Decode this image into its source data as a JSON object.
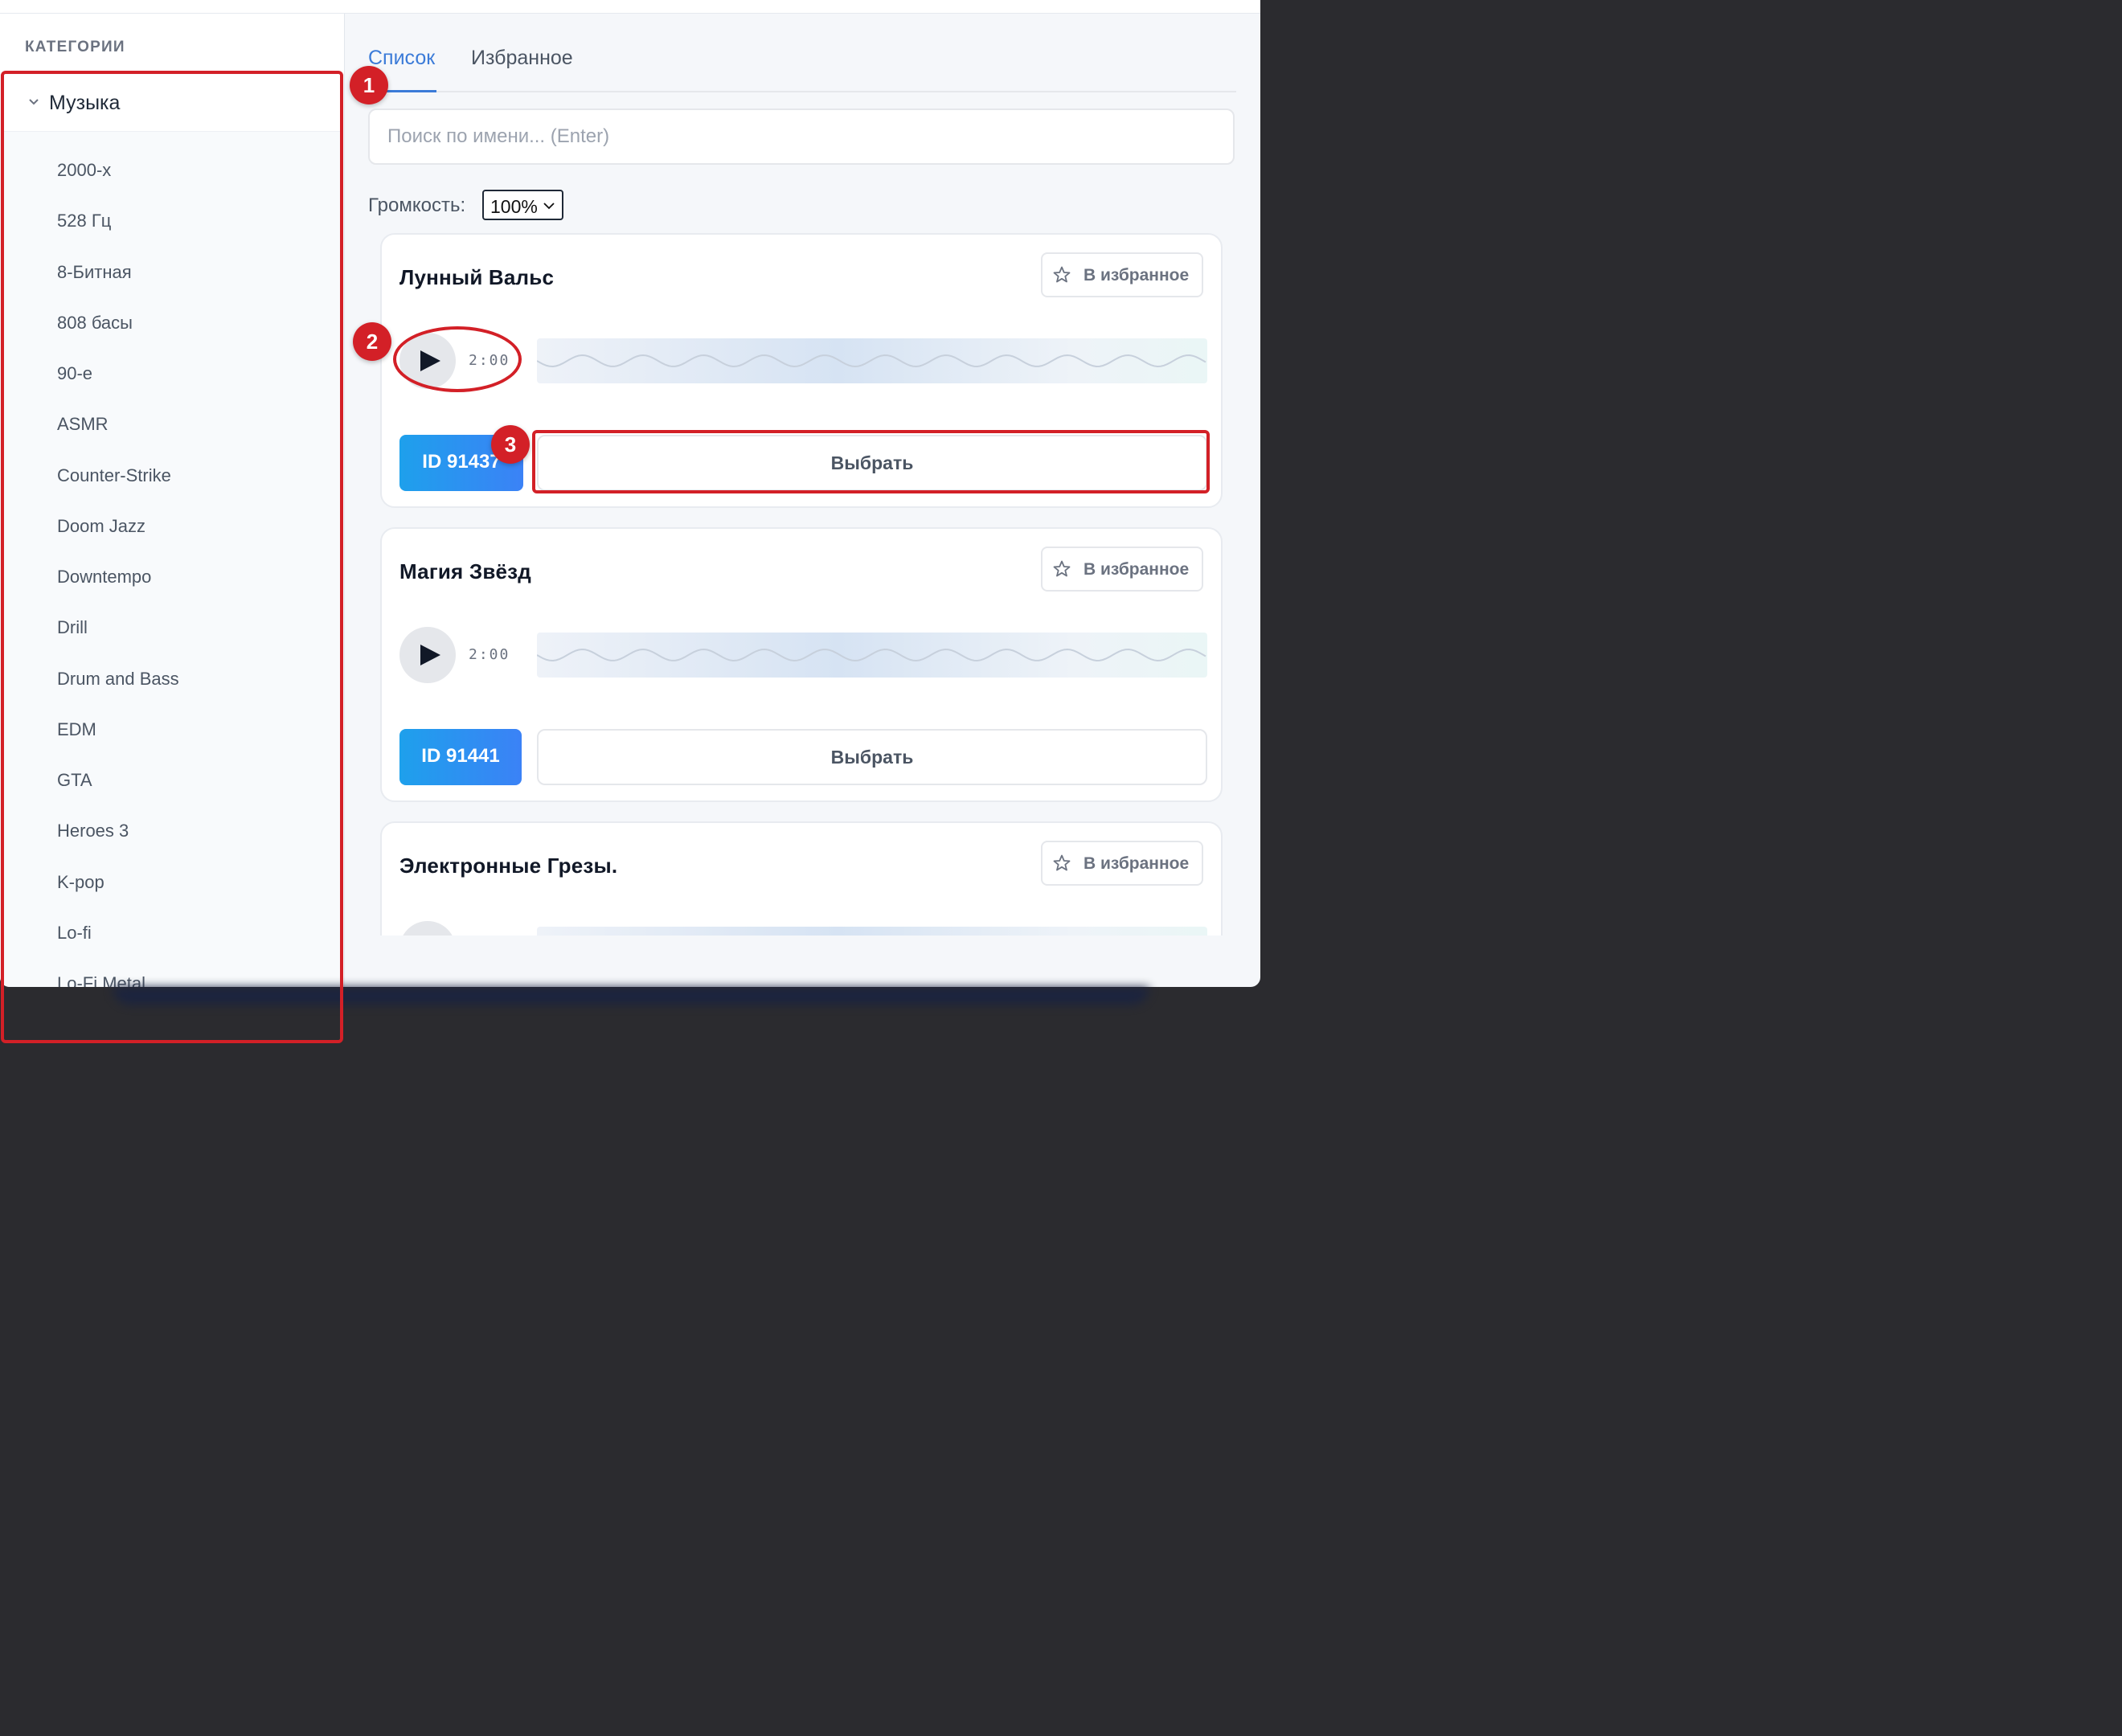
{
  "sidebar": {
    "title": "КАТЕГОРИИ",
    "group": {
      "label": "Музыка",
      "expanded": true
    },
    "items": [
      "2000-х",
      "528 Гц",
      "8-Битная",
      "808 басы",
      "90-е",
      "ASMR",
      "Counter-Strike",
      "Doom Jazz",
      "Downtempo",
      "Drill",
      "Drum and Bass",
      "EDM",
      "GTA",
      "Heroes 3",
      "K-pop",
      "Lo-fi",
      "Lo-Fi Metal"
    ]
  },
  "tabs": [
    {
      "label": "Список",
      "active": true
    },
    {
      "label": "Избранное",
      "active": false
    }
  ],
  "search": {
    "placeholder": "Поиск по имени... (Enter)",
    "value": ""
  },
  "volume": {
    "label": "Громкость:",
    "selected": "100%"
  },
  "tracks": [
    {
      "title": "Лунный Вальс",
      "favorite_label": "В избранное",
      "duration": "2:00",
      "id_label": "ID 91437",
      "select_label": "Выбрать"
    },
    {
      "title": "Магия Звёзд",
      "favorite_label": "В избранное",
      "duration": "2:00",
      "id_label": "ID 91441",
      "select_label": "Выбрать"
    },
    {
      "title": "Электронные Грезы.",
      "favorite_label": "В избранное",
      "duration": "",
      "id_label": "",
      "select_label": ""
    }
  ],
  "annotations": [
    "1",
    "2",
    "3"
  ],
  "colors": {
    "accent": "#3b7bd8",
    "annotation": "#d32027",
    "id_gradient_start": "#1ea0ec",
    "id_gradient_end": "#3b82f6"
  }
}
